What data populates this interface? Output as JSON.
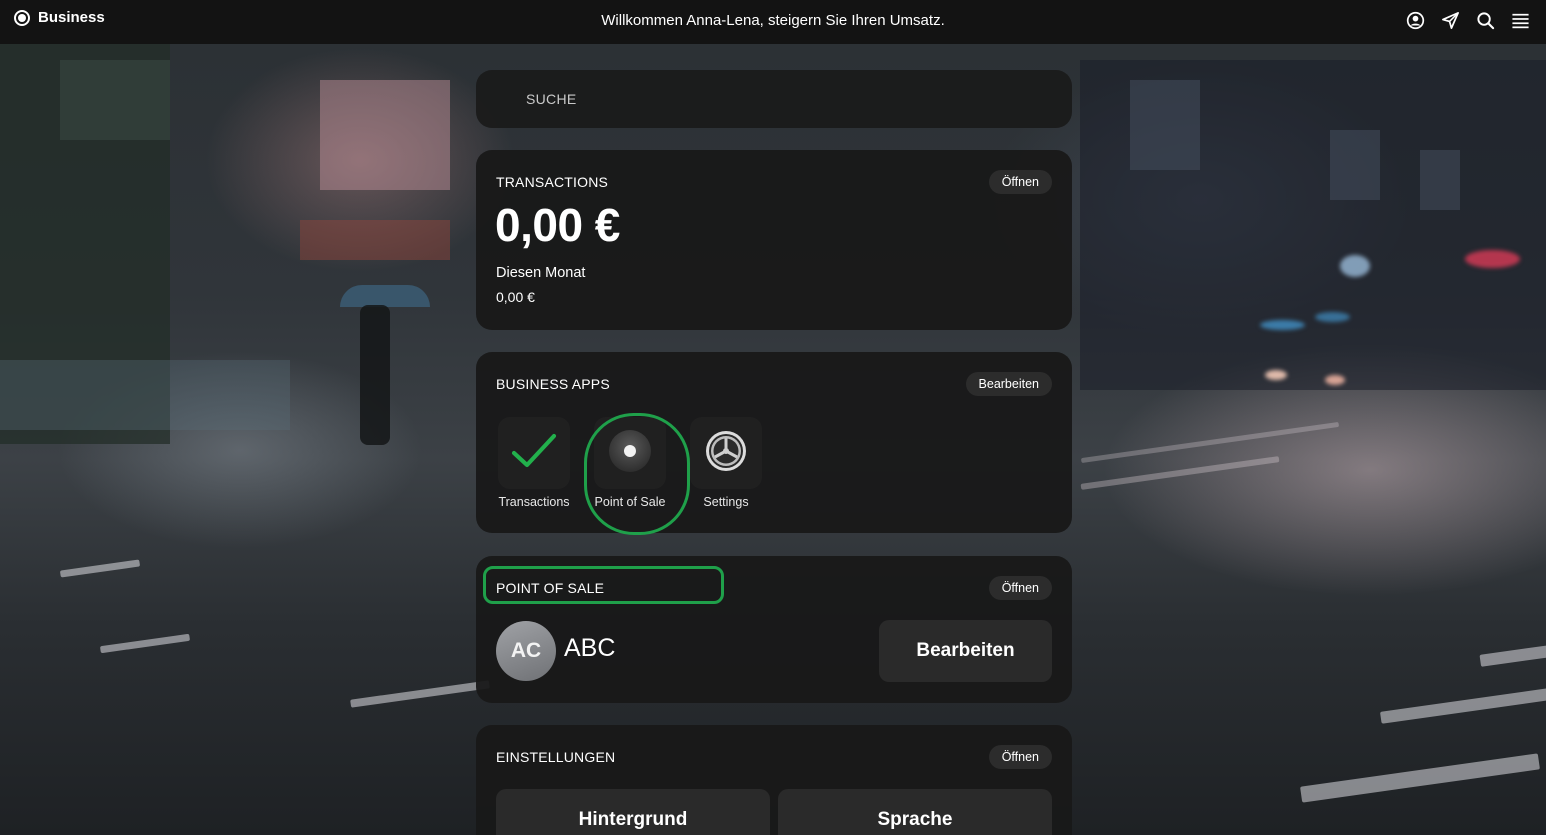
{
  "topbar": {
    "brand": "Business",
    "welcome": "Willkommen Anna-Lena, steigern Sie Ihren Umsatz.",
    "icons": [
      "account-icon",
      "send-icon",
      "search-icon",
      "menu-icon"
    ]
  },
  "search": {
    "placeholder": "SUCHE"
  },
  "transactions": {
    "title": "TRANSACTIONS",
    "open_label": "Öffnen",
    "amount": "0,00 €",
    "month_label": "Diesen Monat",
    "month_value": "0,00 €"
  },
  "business_apps": {
    "title": "BUSINESS APPS",
    "edit_label": "Bearbeiten",
    "apps": [
      {
        "label": "Transactions",
        "icon": "checkmark-icon"
      },
      {
        "label": "Point of Sale",
        "icon": "pos-disc-icon"
      },
      {
        "label": "Settings",
        "icon": "gear-icon"
      }
    ]
  },
  "point_of_sale": {
    "title": "POINT OF SALE",
    "open_label": "Öffnen",
    "avatar_initials": "AC",
    "name": "ABC",
    "edit_label": "Bearbeiten"
  },
  "settings": {
    "title": "EINSTELLUNGEN",
    "open_label": "Öffnen",
    "buttons": [
      "Hintergrund",
      "Sprache"
    ]
  },
  "colors": {
    "accent_green": "#1fa04a",
    "checkmark_green": "#22b04c",
    "topbar_bg": "#131313",
    "card_bg": "#181818"
  }
}
